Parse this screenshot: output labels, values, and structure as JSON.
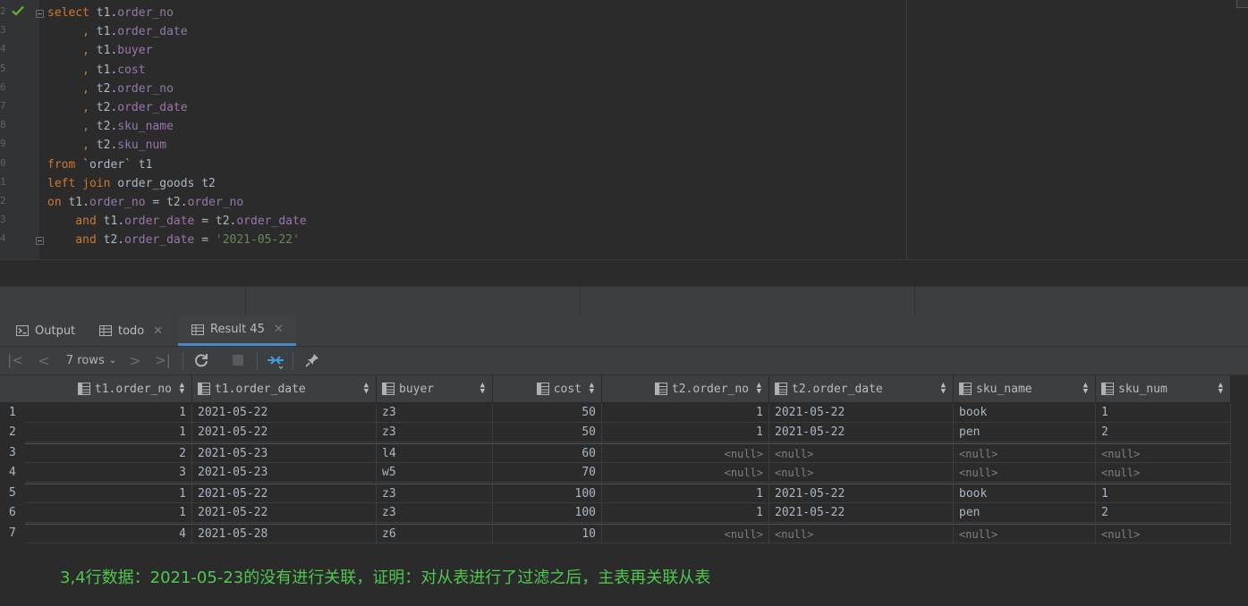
{
  "editor": {
    "line_numbers": [
      "2",
      "3",
      "4",
      "5",
      "6",
      "7",
      "8",
      "9",
      "0",
      "1",
      "2",
      "3",
      "4"
    ],
    "lines": [
      [
        {
          "c": "kw",
          "t": "select "
        },
        {
          "c": "txt",
          "t": "t1."
        },
        {
          "c": "col",
          "t": "order_no"
        }
      ],
      [
        {
          "c": "kw",
          "t": "     , "
        },
        {
          "c": "txt",
          "t": "t1."
        },
        {
          "c": "col",
          "t": "order_date"
        }
      ],
      [
        {
          "c": "kw",
          "t": "     , "
        },
        {
          "c": "txt",
          "t": "t1."
        },
        {
          "c": "col",
          "t": "buyer"
        }
      ],
      [
        {
          "c": "kw",
          "t": "     , "
        },
        {
          "c": "txt",
          "t": "t1."
        },
        {
          "c": "col",
          "t": "cost"
        }
      ],
      [
        {
          "c": "kw",
          "t": "     , "
        },
        {
          "c": "txt",
          "t": "t2."
        },
        {
          "c": "col",
          "t": "order_no"
        }
      ],
      [
        {
          "c": "kw",
          "t": "     , "
        },
        {
          "c": "txt",
          "t": "t2."
        },
        {
          "c": "col",
          "t": "order_date"
        }
      ],
      [
        {
          "c": "kw",
          "t": "     , "
        },
        {
          "c": "txt",
          "t": "t2."
        },
        {
          "c": "col",
          "t": "sku_name"
        }
      ],
      [
        {
          "c": "kw",
          "t": "     , "
        },
        {
          "c": "txt",
          "t": "t2."
        },
        {
          "c": "col",
          "t": "sku_num"
        }
      ],
      [
        {
          "c": "kw",
          "t": "from "
        },
        {
          "c": "txt",
          "t": "`order` t1"
        }
      ],
      [
        {
          "c": "kw",
          "t": "left join "
        },
        {
          "c": "txt",
          "t": "order_goods t2"
        }
      ],
      [
        {
          "c": "kw",
          "t": "on "
        },
        {
          "c": "txt",
          "t": "t1."
        },
        {
          "c": "col",
          "t": "order_no"
        },
        {
          "c": "txt",
          "t": " = t2."
        },
        {
          "c": "col",
          "t": "order_no"
        }
      ],
      [
        {
          "c": "kw",
          "t": "    and "
        },
        {
          "c": "txt",
          "t": "t1."
        },
        {
          "c": "col",
          "t": "order_date"
        },
        {
          "c": "txt",
          "t": " = t2."
        },
        {
          "c": "col",
          "t": "order_date"
        }
      ],
      [
        {
          "c": "kw",
          "t": "    and "
        },
        {
          "c": "txt",
          "t": "t2."
        },
        {
          "c": "col",
          "t": "order_date"
        },
        {
          "c": "txt",
          "t": " = "
        },
        {
          "c": "str",
          "t": "'2021-05-22'"
        }
      ]
    ]
  },
  "tabs": [
    {
      "label": "Output",
      "icon": "output-icon",
      "closable": false
    },
    {
      "label": "todo",
      "icon": "table-icon",
      "closable": true
    },
    {
      "label": "Result 45",
      "icon": "table-icon",
      "closable": true,
      "active": true
    }
  ],
  "toolbar": {
    "rows_label": "7 rows"
  },
  "table": {
    "columns": [
      {
        "label": "t1.order_no",
        "align": "right"
      },
      {
        "label": "t1.order_date",
        "align": "left"
      },
      {
        "label": "buyer",
        "align": "left"
      },
      {
        "label": "cost",
        "align": "right"
      },
      {
        "label": "t2.order_no",
        "align": "right"
      },
      {
        "label": "t2.order_date",
        "align": "left"
      },
      {
        "label": "sku_name",
        "align": "left"
      },
      {
        "label": "sku_num",
        "align": "left"
      }
    ],
    "null_text": "<null>",
    "rows": [
      {
        "num": "1",
        "cells": [
          "1",
          "2021-05-22",
          "z3",
          "50",
          "1",
          "2021-05-22",
          "book",
          "1"
        ]
      },
      {
        "num": "2",
        "cells": [
          "1",
          "2021-05-22",
          "z3",
          "50",
          "1",
          "2021-05-22",
          "pen",
          "2"
        ]
      },
      {
        "num": "3",
        "cells": [
          "2",
          "2021-05-23",
          "l4",
          "60",
          null,
          null,
          null,
          null
        ]
      },
      {
        "num": "4",
        "cells": [
          "3",
          "2021-05-23",
          "w5",
          "70",
          null,
          null,
          null,
          null
        ]
      },
      {
        "num": "5",
        "cells": [
          "1",
          "2021-05-22",
          "z3",
          "100",
          "1",
          "2021-05-22",
          "book",
          "1"
        ]
      },
      {
        "num": "6",
        "cells": [
          "1",
          "2021-05-22",
          "z3",
          "100",
          "1",
          "2021-05-22",
          "pen",
          "2"
        ]
      },
      {
        "num": "7",
        "cells": [
          "4",
          "2021-05-28",
          "z6",
          "10",
          null,
          null,
          null,
          null
        ]
      }
    ]
  },
  "note": "3,4行数据：2021-05-23的没有进行关联，证明：对从表进行了过滤之后，主表再关联从表",
  "colors": {
    "accent": "#4a88c7",
    "note": "#4ec84e",
    "check": "#5fb832"
  }
}
